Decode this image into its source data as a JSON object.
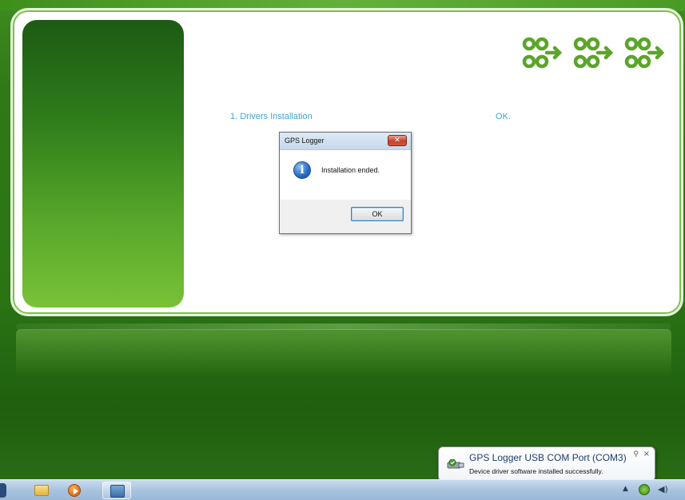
{
  "installer": {
    "step_label": "1. Drivers Installation",
    "step_status": "OK."
  },
  "dialog": {
    "title": "GPS Logger",
    "close_glyph": "✕",
    "icon": "info-icon",
    "icon_glyph": "i",
    "message": "Installation ended.",
    "ok_label": "OK"
  },
  "notification": {
    "title": "GPS Logger USB COM Port (COM3)",
    "subtitle": "Device driver software installed successfully.",
    "pin_glyph": "⚲",
    "close_glyph": "×"
  },
  "taskbar": {
    "items": [
      {
        "icon": "folder-icon"
      },
      {
        "icon": "media-player-icon"
      },
      {
        "icon": "setup-app-icon"
      }
    ],
    "tray": {
      "arrow_glyph": "▲",
      "volume_glyph": "◀)"
    }
  },
  "colors": {
    "accent_text": "#3aa6d6",
    "desktop_green": "#2f7a16",
    "logo_green": "#5aa52a"
  }
}
